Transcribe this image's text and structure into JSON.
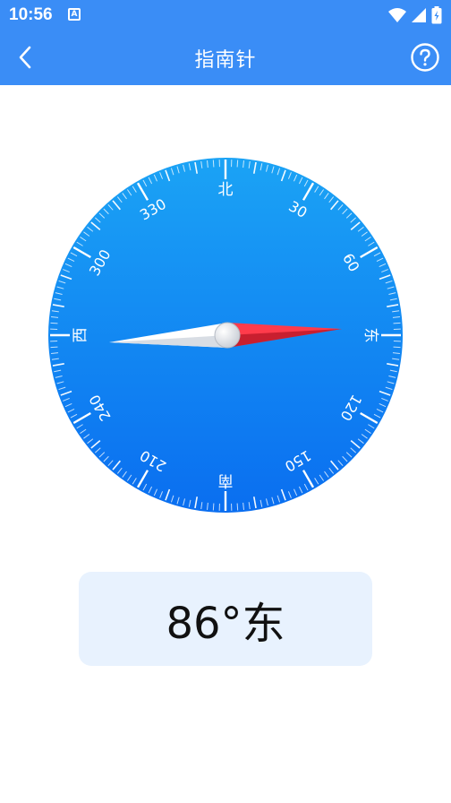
{
  "status_bar": {
    "time": "10:56",
    "notification_glyph": "A",
    "icons": [
      "wifi-icon",
      "signal-icon",
      "battery-icon"
    ]
  },
  "app_bar": {
    "title": "指南针",
    "back_icon": "chevron-left-icon",
    "help_icon": "question-circle-icon"
  },
  "compass": {
    "labels": [
      {
        "angle": 0,
        "text": "北"
      },
      {
        "angle": 30,
        "text": "30"
      },
      {
        "angle": 60,
        "text": "60"
      },
      {
        "angle": 90,
        "text": "东"
      },
      {
        "angle": 120,
        "text": "120"
      },
      {
        "angle": 150,
        "text": "150"
      },
      {
        "angle": 180,
        "text": "南"
      },
      {
        "angle": 210,
        "text": "210"
      },
      {
        "angle": 240,
        "text": "240"
      },
      {
        "angle": 270,
        "text": "西"
      },
      {
        "angle": 300,
        "text": "300"
      },
      {
        "angle": 330,
        "text": "330"
      }
    ],
    "heading_degrees": 86,
    "needle_north_color": "#e8283a",
    "needle_south_color": "#ffffff",
    "dial_color_top": "#1ba3f5",
    "dial_color_bottom": "#0a6ef0"
  },
  "reading": {
    "text": "86°东"
  },
  "colors": {
    "primary": "#3a8df6",
    "panel_bg": "#e8f2fe"
  }
}
